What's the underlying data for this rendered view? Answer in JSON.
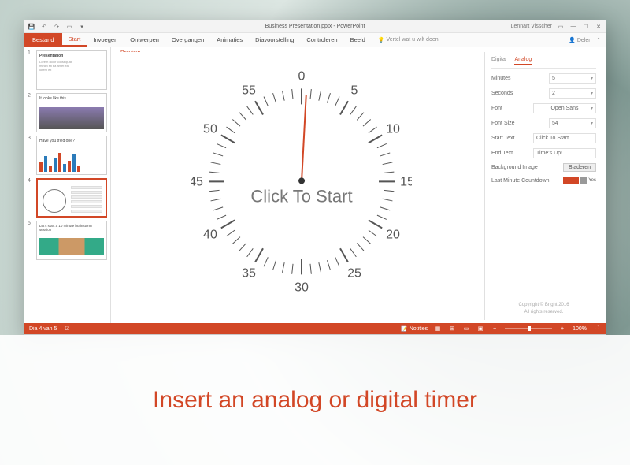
{
  "qat": {
    "title": "Business Presentation.pptx - PowerPoint",
    "user": "Lennart Visscher"
  },
  "ribbon": {
    "file": "Bestand",
    "tabs": [
      "Start",
      "Invoegen",
      "Ontwerpen",
      "Overgangen",
      "Animaties",
      "Diavoorstelling",
      "Controleren",
      "Beeld"
    ],
    "tell_me": "Vertel wat u wilt doen",
    "share": "Delen"
  },
  "thumbs": [
    {
      "n": "1",
      "title": "Presentation"
    },
    {
      "n": "2",
      "title": "It looks like this..."
    },
    {
      "n": "3",
      "title": "Have you tried one?"
    },
    {
      "n": "4",
      "title": ""
    },
    {
      "n": "5",
      "title": "Let's start a 10 minute brainstorm session"
    }
  ],
  "preview": {
    "label": "Preview",
    "click_text": "Click To Start"
  },
  "clock": {
    "numbers": [
      "0",
      "5",
      "10",
      "15",
      "20",
      "25",
      "30",
      "35",
      "40",
      "45",
      "50",
      "55"
    ]
  },
  "panel": {
    "tab_digital": "Digital",
    "tab_analog": "Analog",
    "minutes_label": "Minutes",
    "minutes_val": "5",
    "seconds_label": "Seconds",
    "seconds_val": "2",
    "font_label": "Font",
    "font_val": "Open Sans",
    "fontsize_label": "Font Size",
    "fontsize_val": "54",
    "starttext_label": "Start Text",
    "starttext_val": "Click To Start",
    "endtext_label": "End Text",
    "endtext_val": "Time's Up!",
    "bg_label": "Background Image",
    "bg_btn": "Bladeren",
    "lastmin_label": "Last Minute Countdown",
    "lastmin_yes": "Yes",
    "copyright": "Copyright © Bright 2016",
    "rights": "All rights reserved."
  },
  "status": {
    "slide": "Dia 4 van 5",
    "notes": "Notities",
    "zoom": "100%"
  },
  "caption": "Insert an analog or digital timer"
}
